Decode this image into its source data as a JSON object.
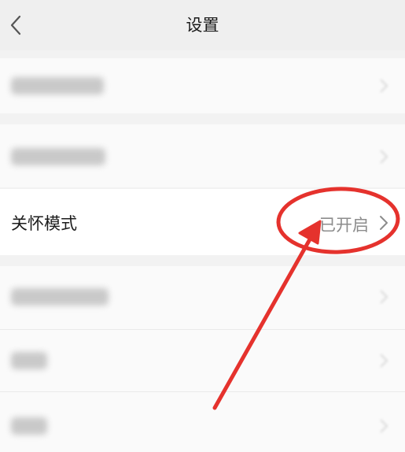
{
  "header": {
    "title": "设置",
    "back_icon": "chevron-left-icon"
  },
  "settings": {
    "care_mode": {
      "label": "关怀模式",
      "status": "已开启",
      "chevron_icon": "chevron-right-icon"
    }
  },
  "annotation": {
    "color": "#e5322d",
    "shapes": [
      "red-circle",
      "red-arrow"
    ]
  }
}
